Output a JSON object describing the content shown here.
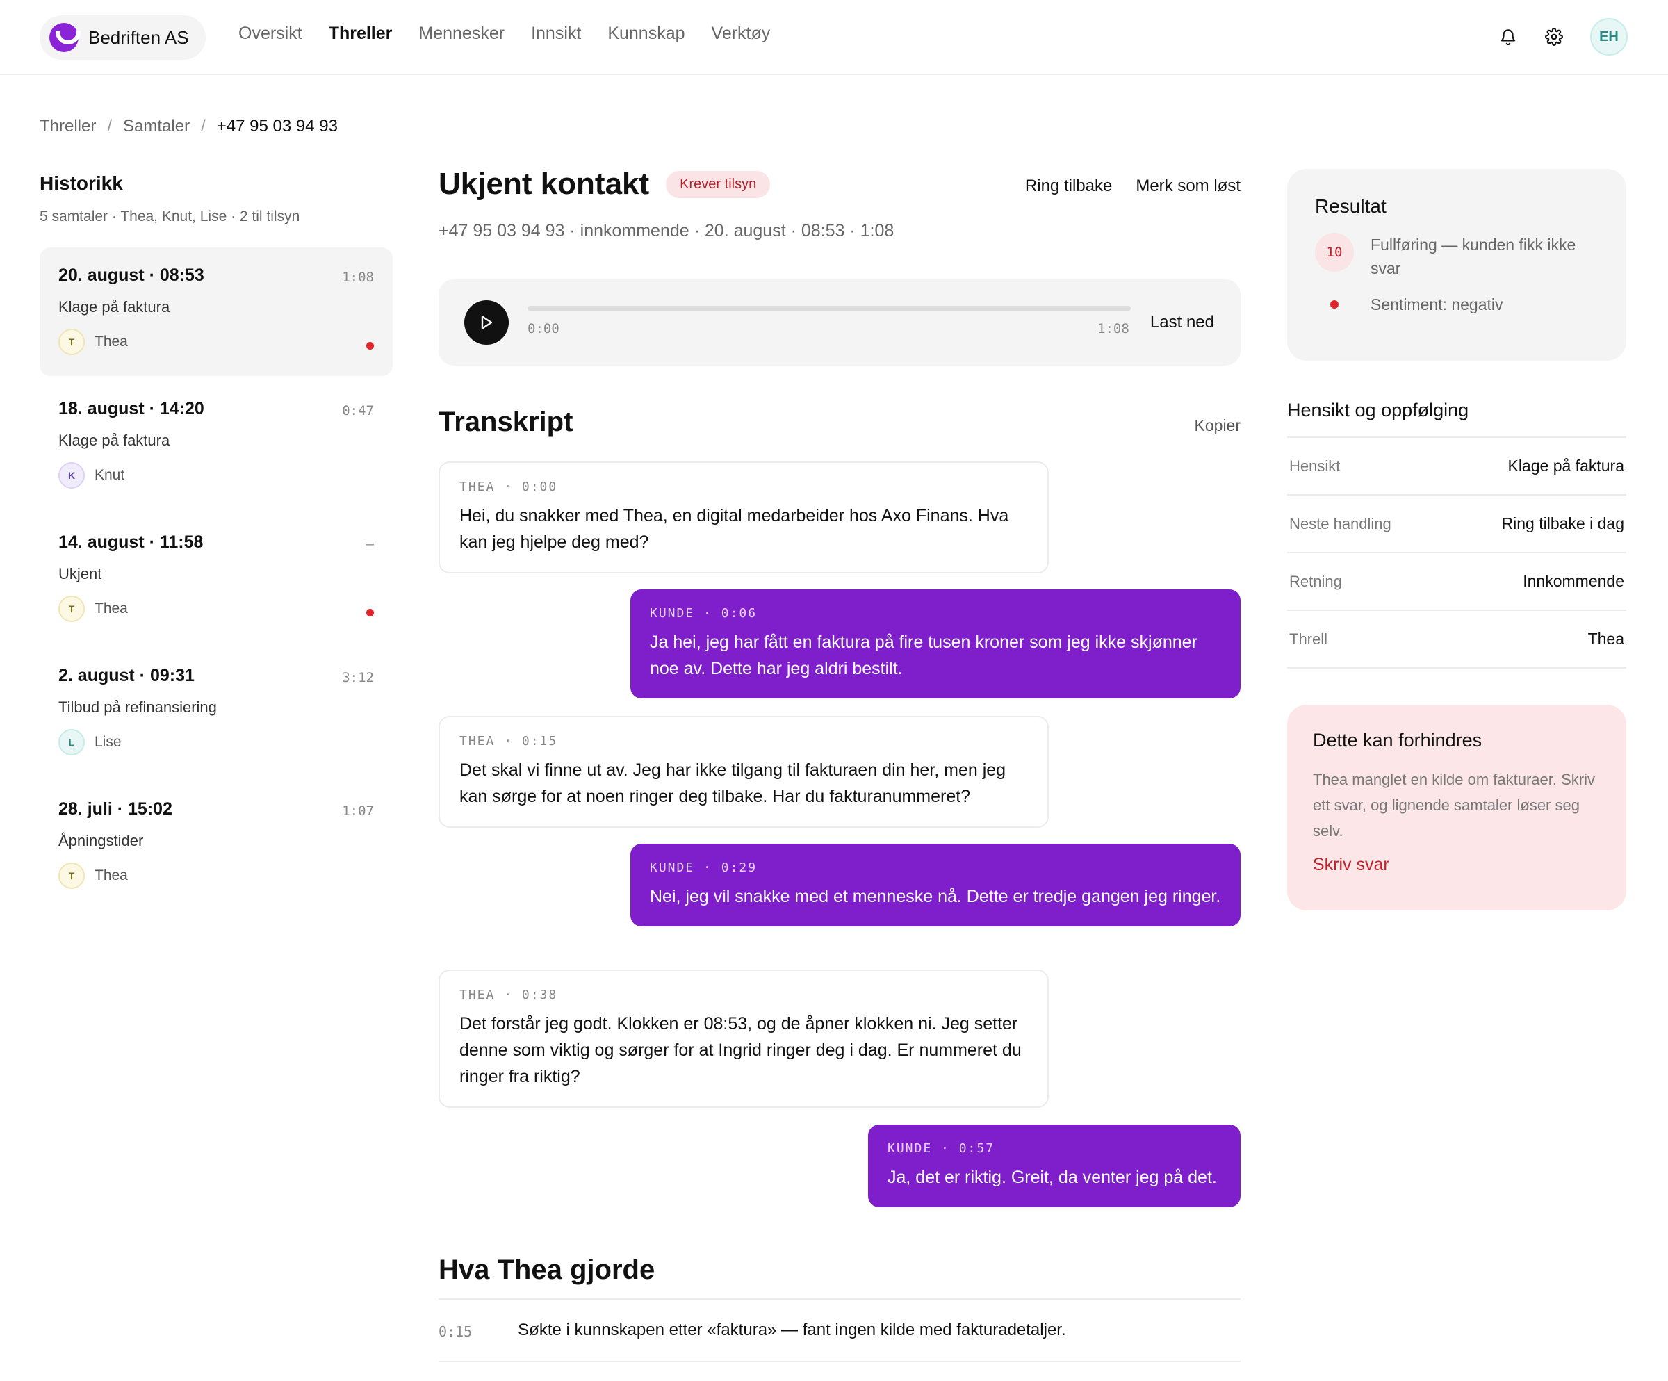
{
  "brand": {
    "name": "Bedriften AS",
    "logo_icon": "smile-logo-icon",
    "color": "#8b23d6"
  },
  "nav": [
    {
      "label": "Oversikt",
      "active": false
    },
    {
      "label": "Threller",
      "active": true
    },
    {
      "label": "Mennesker",
      "active": false
    },
    {
      "label": "Innsikt",
      "active": false
    },
    {
      "label": "Kunnskap",
      "active": false
    },
    {
      "label": "Verktøy",
      "active": false
    }
  ],
  "user": {
    "initials": "EH"
  },
  "breadcrumb": {
    "a": "Threller",
    "b": "Samtaler",
    "current": "+47 95 03 94 93",
    "sep": "/"
  },
  "history": {
    "title": "Historikk",
    "subtitle": "5 samtaler · Thea, Knut, Lise · 2 til tilsyn",
    "items": [
      {
        "date": "20. august · 08:53",
        "duration": "1:08",
        "topic": "Klage på faktura",
        "agent": "Thea",
        "agent_initial": "T",
        "flagged": true,
        "selected": true
      },
      {
        "date": "18. august · 14:20",
        "duration": "0:47",
        "topic": "Klage på faktura",
        "agent": "Knut",
        "agent_initial": "K",
        "flagged": false,
        "selected": false
      },
      {
        "date": "14. august · 11:58",
        "duration": "–",
        "topic": "Ukjent",
        "agent": "Thea",
        "agent_initial": "T",
        "flagged": true,
        "selected": false
      },
      {
        "date": "2. august · 09:31",
        "duration": "3:12",
        "topic": "Tilbud på refinansiering",
        "agent": "Lise",
        "agent_initial": "L",
        "flagged": false,
        "selected": false
      },
      {
        "date": "28. juli · 15:02",
        "duration": "1:07",
        "topic": "Åpningstider",
        "agent": "Thea",
        "agent_initial": "T",
        "flagged": false,
        "selected": false
      }
    ]
  },
  "contact": {
    "title": "Ukjent kontakt",
    "badge": "Krever tilsyn",
    "meta": "+47  95  03  94  93 · innkommende · 20. august · 08:53 · 1:08",
    "call_back": "Ring tilbake",
    "mark_resolved": "Merk som løst"
  },
  "player": {
    "start": "0:00",
    "end": "1:08",
    "download": "Last ned",
    "progress": 0
  },
  "transcript": {
    "title": "Transkript",
    "copy": "Kopier",
    "messages": [
      {
        "speaker": "THEA",
        "time": "0:00",
        "role": "agent",
        "text": "Hei, du snakker med Thea, en digital medarbeider hos Axo Finans. Hva kan jeg hjelpe deg med?"
      },
      {
        "speaker": "KUNDE",
        "time": "0:06",
        "role": "customer",
        "text": "Ja hei, jeg har fått en faktura på fire tusen kroner som jeg ikke skjønner noe av. Dette har jeg aldri bestilt."
      },
      {
        "speaker": "THEA",
        "time": "0:15",
        "role": "agent",
        "text": "Det skal vi finne ut av. Jeg har ikke tilgang til fakturaen din her, men jeg kan sørge for at noen ringer deg tilbake. Har du fakturanummeret?"
      },
      {
        "speaker": "KUNDE",
        "time": "0:29",
        "role": "customer",
        "text": "Nei, jeg vil snakke med et menneske nå. Dette er tredje gangen jeg ringer."
      },
      {
        "speaker": "THEA",
        "time": "0:38",
        "role": "agent",
        "text": "Det forstår jeg godt. Klokken er 08:53, og de åpner klokken ni. Jeg setter denne som viktig og sørger for at Ingrid ringer deg i dag. Er nummeret du ringer fra riktig?"
      },
      {
        "speaker": "KUNDE",
        "time": "0:57",
        "role": "customer",
        "text": "Ja, det er riktig. Greit, da venter jeg på det."
      }
    ]
  },
  "actions": {
    "title": "Hva Thea gjorde",
    "rows": [
      {
        "time": "0:15",
        "text": "Søkte i kunnskapen etter «faktura» — fant ingen kilde med fakturadetaljer."
      }
    ]
  },
  "result": {
    "title": "Resultat",
    "score": "10",
    "completion": "Fullføring — kunden fikk ikke svar",
    "sentiment": "Sentiment: negativ"
  },
  "intent": {
    "title": "Hensikt og oppfølging",
    "rows": [
      {
        "key": "Hensikt",
        "value": "Klage på faktura"
      },
      {
        "key": "Neste handling",
        "value": "Ring tilbake i dag"
      },
      {
        "key": "Retning",
        "value": "Innkommende"
      },
      {
        "key": "Threll",
        "value": "Thea"
      }
    ]
  },
  "prevent": {
    "title": "Dette kan forhindres",
    "text": "Thea manglet en kilde om fakturaer. Skriv ett svar, og lignende samtaler løser seg selv.",
    "link": "Skriv svar"
  }
}
